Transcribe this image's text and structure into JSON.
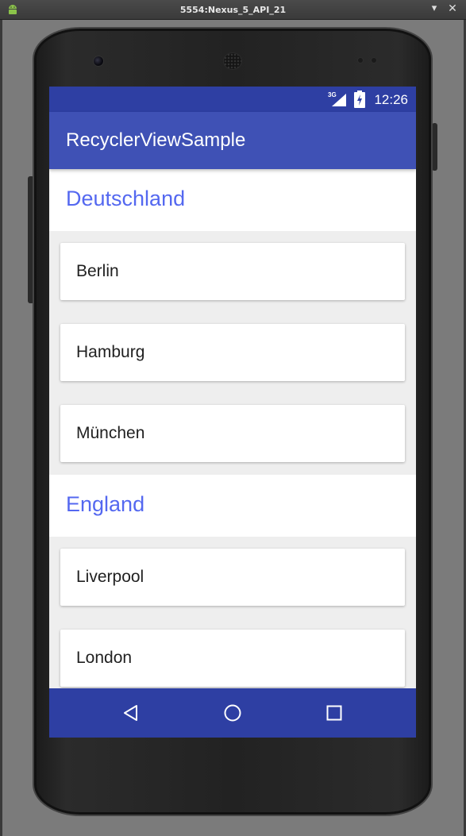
{
  "window": {
    "title": "5554:Nexus_5_API_21",
    "app_icon": "android-icon",
    "minimize_icon": "minimize-icon",
    "close_icon": "close-icon"
  },
  "status_bar": {
    "network": "3G",
    "time": "12:26",
    "icons": [
      "signal-icon",
      "battery-charging-icon"
    ]
  },
  "app_bar": {
    "title": "RecyclerViewSample"
  },
  "sections": [
    {
      "header": "Deutschland",
      "items": [
        "Berlin",
        "Hamburg",
        "München"
      ]
    },
    {
      "header": "England",
      "items": [
        "Liverpool",
        "London"
      ]
    }
  ],
  "nav_bar": {
    "buttons": [
      "back-icon",
      "home-icon",
      "recent-apps-icon"
    ]
  },
  "colors": {
    "primary": "#3f51b5",
    "primary_dark": "#2e3fa3",
    "section_header_text": "#5468f0",
    "list_background": "#eeeeee"
  }
}
